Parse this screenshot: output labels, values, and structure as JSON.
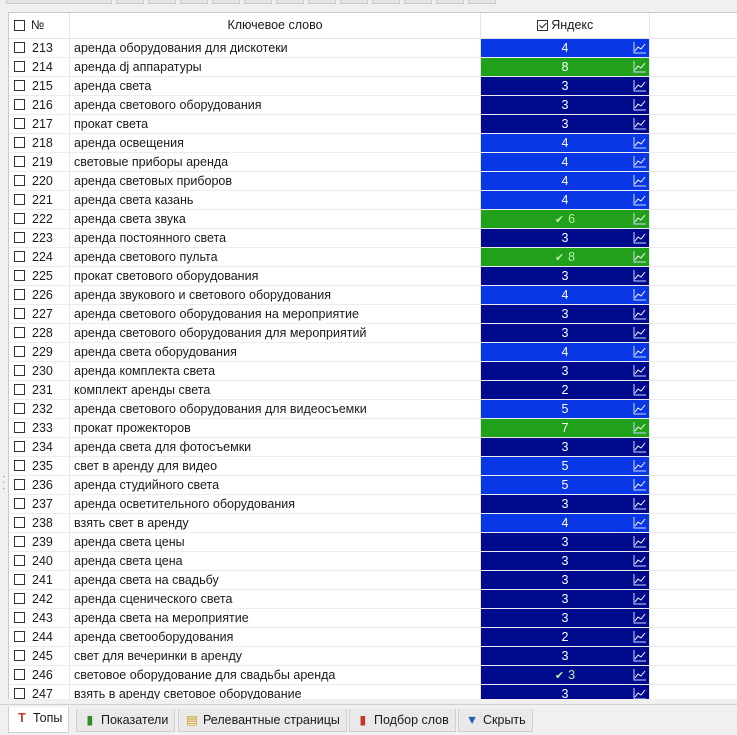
{
  "colors": {
    "yellow_cell": "#d4d400",
    "navy": "#000a8c",
    "blue": "#0a37e6",
    "green": "#21a01c"
  },
  "header": {
    "num_label": "№",
    "keyword_label": "Ключевое слово",
    "yandex_label": "Яндекс"
  },
  "rows": [
    {
      "num": "213",
      "keyword": "аренда оборудования для дискотеки",
      "value": "4",
      "color": "blue",
      "ok": false
    },
    {
      "num": "214",
      "keyword": "аренда dj аппаратуры",
      "value": "8",
      "color": "green",
      "ok": false
    },
    {
      "num": "215",
      "keyword": "аренда света",
      "value": "3",
      "color": "navy",
      "ok": false
    },
    {
      "num": "216",
      "keyword": "аренда светового оборудования",
      "value": "3",
      "color": "navy",
      "ok": false
    },
    {
      "num": "217",
      "keyword": "прокат света",
      "value": "3",
      "color": "navy",
      "ok": false
    },
    {
      "num": "218",
      "keyword": "аренда освещения",
      "value": "4",
      "color": "blue",
      "ok": false
    },
    {
      "num": "219",
      "keyword": "световые приборы аренда",
      "value": "4",
      "color": "blue",
      "ok": false
    },
    {
      "num": "220",
      "keyword": "аренда световых приборов",
      "value": "4",
      "color": "blue",
      "ok": false
    },
    {
      "num": "221",
      "keyword": "аренда света казань",
      "value": "4",
      "color": "blue",
      "ok": false
    },
    {
      "num": "222",
      "keyword": "аренда света звука",
      "value": "6",
      "color": "green",
      "ok": true
    },
    {
      "num": "223",
      "keyword": "аренда постоянного света",
      "value": "3",
      "color": "navy",
      "ok": false
    },
    {
      "num": "224",
      "keyword": "аренда светового пульта",
      "value": "8",
      "color": "green",
      "ok": true
    },
    {
      "num": "225",
      "keyword": "прокат светового оборудования",
      "value": "3",
      "color": "navy",
      "ok": false
    },
    {
      "num": "226",
      "keyword": "аренда звукового и светового оборудования",
      "value": "4",
      "color": "blue",
      "ok": false
    },
    {
      "num": "227",
      "keyword": "аренда светового оборудования на мероприятие",
      "value": "3",
      "color": "navy",
      "ok": false
    },
    {
      "num": "228",
      "keyword": "аренда светового оборудования для мероприятий",
      "value": "3",
      "color": "navy",
      "ok": false
    },
    {
      "num": "229",
      "keyword": "аренда света оборудования",
      "value": "4",
      "color": "blue",
      "ok": false
    },
    {
      "num": "230",
      "keyword": "аренда комплекта света",
      "value": "3",
      "color": "navy",
      "ok": false
    },
    {
      "num": "231",
      "keyword": "комплект аренды света",
      "value": "2",
      "color": "navy",
      "ok": false
    },
    {
      "num": "232",
      "keyword": "аренда светового оборудования для видеосъемки",
      "value": "5",
      "color": "blue",
      "ok": false
    },
    {
      "num": "233",
      "keyword": "прокат прожекторов",
      "value": "7",
      "color": "green",
      "ok": false
    },
    {
      "num": "234",
      "keyword": "аренда света для фотосъемки",
      "value": "3",
      "color": "navy",
      "ok": false
    },
    {
      "num": "235",
      "keyword": "свет в аренду для видео",
      "value": "5",
      "color": "blue",
      "ok": false
    },
    {
      "num": "236",
      "keyword": "аренда студийного света",
      "value": "5",
      "color": "blue",
      "ok": false
    },
    {
      "num": "237",
      "keyword": "аренда осветительного оборудования",
      "value": "3",
      "color": "navy",
      "ok": false
    },
    {
      "num": "238",
      "keyword": "взять свет в аренду",
      "value": "4",
      "color": "blue",
      "ok": false
    },
    {
      "num": "239",
      "keyword": "аренда света цены",
      "value": "3",
      "color": "navy",
      "ok": false
    },
    {
      "num": "240",
      "keyword": "аренда света цена",
      "value": "3",
      "color": "navy",
      "ok": false
    },
    {
      "num": "241",
      "keyword": "аренда света на свадьбу",
      "value": "3",
      "color": "navy",
      "ok": false
    },
    {
      "num": "242",
      "keyword": "аренда сценического света",
      "value": "3",
      "color": "navy",
      "ok": false
    },
    {
      "num": "243",
      "keyword": "аренда света на мероприятие",
      "value": "3",
      "color": "navy",
      "ok": false
    },
    {
      "num": "244",
      "keyword": "аренда светооборудования",
      "value": "2",
      "color": "navy",
      "ok": false
    },
    {
      "num": "245",
      "keyword": "свет для вечеринки в аренду",
      "value": "3",
      "color": "navy",
      "ok": false
    },
    {
      "num": "246",
      "keyword": "световое оборудование для свадьбы аренда",
      "value": "3",
      "color": "navy",
      "ok": true
    },
    {
      "num": "247",
      "keyword": "взять в аренду световое оборудование",
      "value": "3",
      "color": "navy",
      "ok": false
    }
  ],
  "tabs": [
    {
      "label": "Топы",
      "icon": "T",
      "icon_name": "tops-icon",
      "icon_color": "#c0392b",
      "active": true
    },
    {
      "label": "Показатели",
      "icon": "▮",
      "icon_name": "bar-chart-icon",
      "icon_color": "#2e8b2e",
      "active": false
    },
    {
      "label": "Релевантные страницы",
      "icon": "▤",
      "icon_name": "page-icon",
      "icon_color": "#d4a017",
      "active": false
    },
    {
      "label": "Подбор слов",
      "icon": "▮",
      "icon_name": "word-chart-icon",
      "icon_color": "#c0392b",
      "active": false
    },
    {
      "label": "Скрыть",
      "icon": "▼",
      "icon_name": "collapse-icon",
      "icon_color": "#1f5fbf",
      "active": false
    }
  ]
}
